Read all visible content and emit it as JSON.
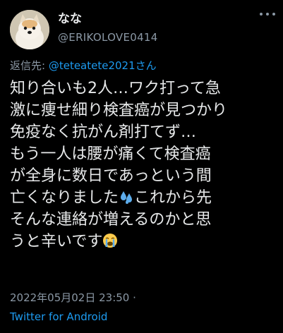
{
  "tweet": {
    "display_name": "なな",
    "handle": "@ERIKOLOVE0414",
    "reply_prefix": "返信先: ",
    "reply_mention": "@teteatete2021さん",
    "body_lines": [
      "知り合いも2人…ワク打って急",
      "激に痩せ細り検査癌が見つかり",
      "免疫なく抗がん剤打てず…",
      "もう一人は腰が痛くて検査癌",
      "が全身に数日であっという間",
      "亡くなりました",
      "これから先",
      "そんな連絡が増えるのかと思",
      "うと辛いです"
    ],
    "emojis": {
      "sweat": "sweat-droplets-icon",
      "crying": "loudly-crying-face-icon"
    },
    "timestamp": "2022年05月02日 23:50 ·",
    "source": "Twitter for Android"
  },
  "colors": {
    "background": "#000000",
    "text": "#e7e9ea",
    "muted": "#8b98a5",
    "link": "#1d9bf0"
  }
}
